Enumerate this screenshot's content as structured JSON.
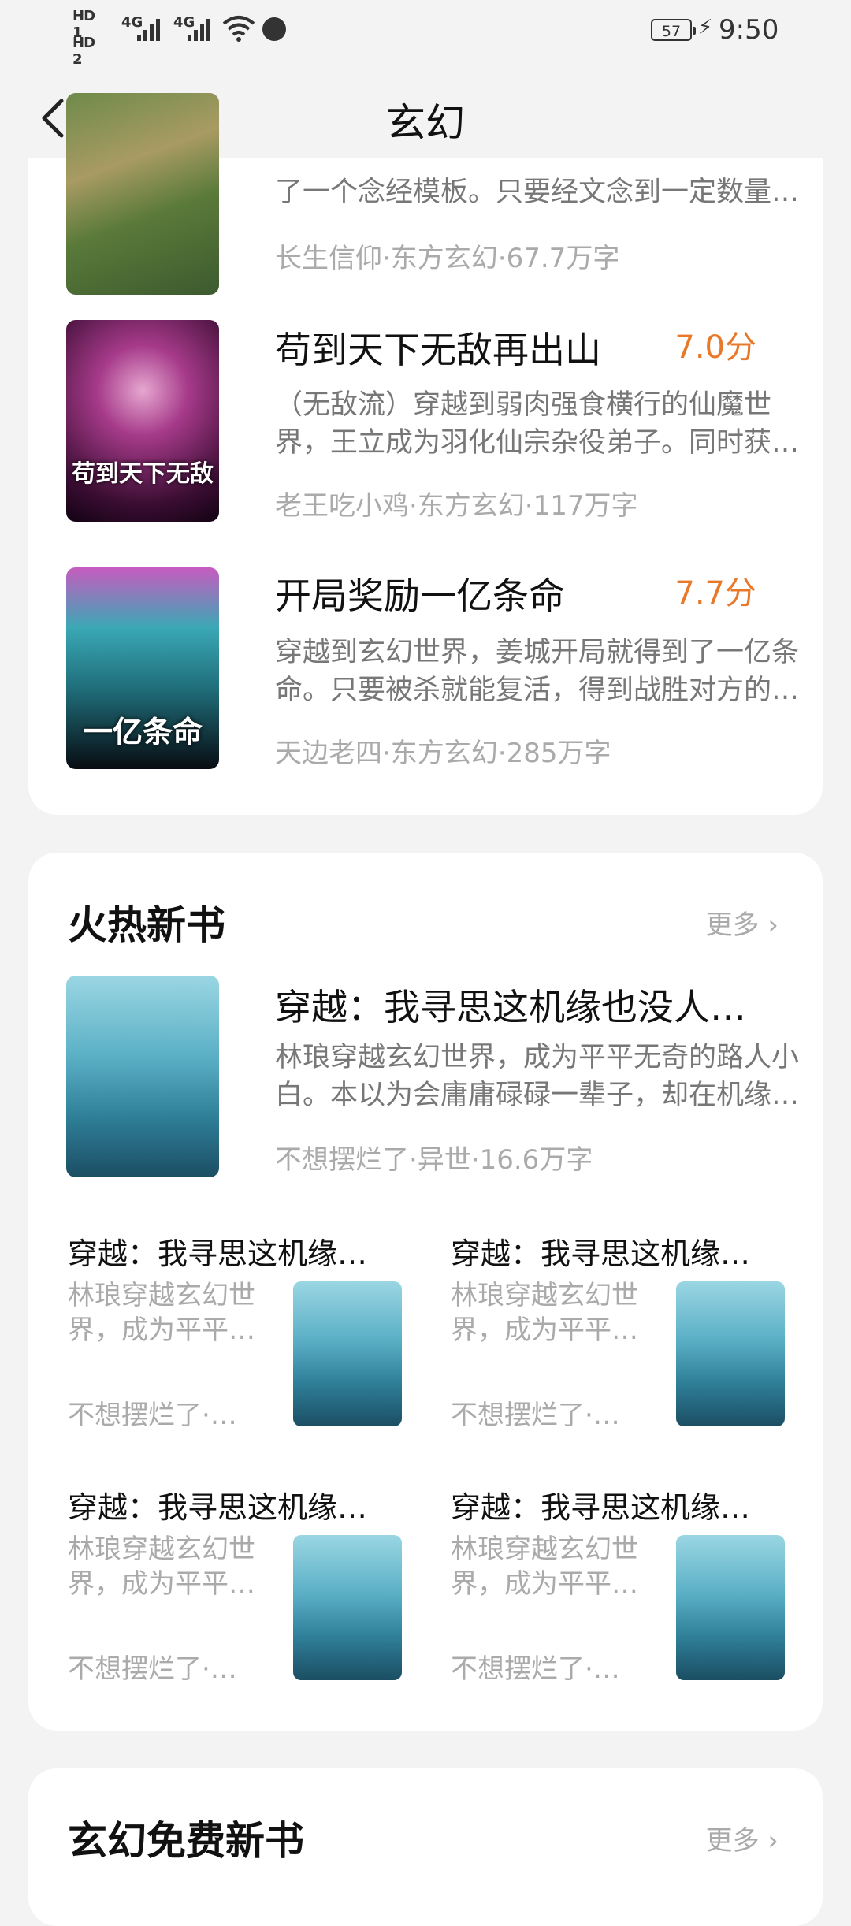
{
  "status": {
    "hd1": "HD 1",
    "hd2": "HD 2",
    "net1": "4G",
    "net2": "4G",
    "battery": "57",
    "time": "9:50"
  },
  "header": {
    "title": "玄幻"
  },
  "books": [
    {
      "title": "",
      "score": "",
      "desc": "了一个念经模板。只要经文念到一定数量…",
      "meta": "长生信仰·东方玄幻·67.7万字"
    },
    {
      "title": "苟到天下无敌再出山",
      "score": "7.0分",
      "desc": "（无敌流）穿越到弱肉强食横行的仙魔世界，王立成为羽化仙宗杂役弟子。同时获…",
      "meta": "老王吃小鸡·东方玄幻·117万字",
      "cover_text": "苟到天下无敌"
    },
    {
      "title": "开局奖励一亿条命",
      "score": "7.7分",
      "desc": "穿越到玄幻世界，姜城开局就得到了一亿条命。只要被杀就能复活，得到战胜对方的…",
      "meta": "天边老四·东方玄幻·285万字",
      "cover_text": "一亿条命"
    }
  ],
  "hot": {
    "section_title": "火热新书",
    "more": "更多 ›",
    "featured": {
      "title": "穿越：我寻思这机缘也没人…",
      "desc": "林琅穿越玄幻世界，成为平平无奇的路人小白。本以为会庸庸碌碌一辈子，却在机缘…",
      "meta": "不想摆烂了·异世·16.6万字"
    },
    "grid": [
      {
        "title": "穿越：我寻思这机缘…",
        "desc": "林琅穿越玄幻世界，成为平平…",
        "meta": "不想摆烂了·…"
      },
      {
        "title": "穿越：我寻思这机缘…",
        "desc": "林琅穿越玄幻世界，成为平平…",
        "meta": "不想摆烂了·…"
      },
      {
        "title": "穿越：我寻思这机缘…",
        "desc": "林琅穿越玄幻世界，成为平平…",
        "meta": "不想摆烂了·…"
      },
      {
        "title": "穿越：我寻思这机缘…",
        "desc": "林琅穿越玄幻世界，成为平平…",
        "meta": "不想摆烂了·…"
      }
    ]
  },
  "free": {
    "section_title": "玄幻免费新书",
    "more": "更多 ›"
  },
  "colors": {
    "score": "#e8782a",
    "background": "#f3f3f3",
    "card": "#ffffff"
  },
  "icons": [
    "signal-icon",
    "wifi-icon",
    "globe-icon",
    "battery-icon",
    "charging-icon",
    "back-arrow-icon",
    "chevron-right-icon"
  ]
}
